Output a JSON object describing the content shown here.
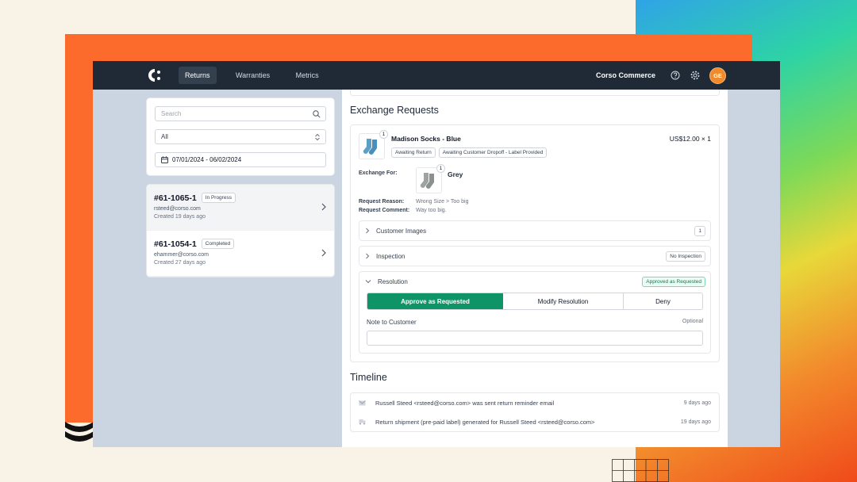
{
  "colors": {
    "accent": "#0f9467",
    "brand_orange": "#fd6b2c",
    "topbar": "#1f2a36"
  },
  "nav": {
    "items": [
      "Returns",
      "Warranties",
      "Metrics"
    ],
    "company": "Corso Commerce",
    "avatar": "GE"
  },
  "filters": {
    "search_placeholder": "Search",
    "status": "All",
    "date_range": "07/01/2024 - 06/02/2024"
  },
  "returns": [
    {
      "id": "#61-1065-1",
      "status": "In Progress",
      "email": "rsteed@corso.com",
      "created": "Created 19 days ago"
    },
    {
      "id": "#61-1054-1",
      "status": "Completed",
      "email": "ehammer@corso.com",
      "created": "Created 27 days ago"
    }
  ],
  "exchange": {
    "heading": "Exchange Requests",
    "product": "Madison Socks - Blue",
    "qty": "1",
    "price": "US$12.00 × 1",
    "tags": [
      "Awaiting Return",
      "Awaiting Customer Dropoff - Label Provided"
    ],
    "exchange_for_label": "Exchange For:",
    "exchange_for_value": "Grey",
    "exchange_qty": "1",
    "reason_label": "Request Reason:",
    "reason_value": "Wrong Size > Too big",
    "comment_label": "Request Comment:",
    "comment_value": "Way too big.",
    "customer_images": "Customer Images",
    "customer_images_count": "1",
    "inspection": "Inspection",
    "inspection_badge": "No Inspection",
    "resolution": "Resolution",
    "resolution_badge": "Approved as Requested",
    "buttons": [
      "Approve as Requested",
      "Modify Resolution",
      "Deny"
    ],
    "note_label": "Note to Customer",
    "note_optional": "Optional"
  },
  "timeline": {
    "heading": "Timeline",
    "events": [
      {
        "text": "Russell Steed <rsteed@corso.com> was sent return reminder email",
        "ago": "9 days ago",
        "icon": "mail-icon"
      },
      {
        "text": "Return shipment (pre-paid label) generated for Russell Steed <rsteed@corso.com>",
        "ago": "19 days ago",
        "icon": "truck-icon"
      }
    ]
  }
}
